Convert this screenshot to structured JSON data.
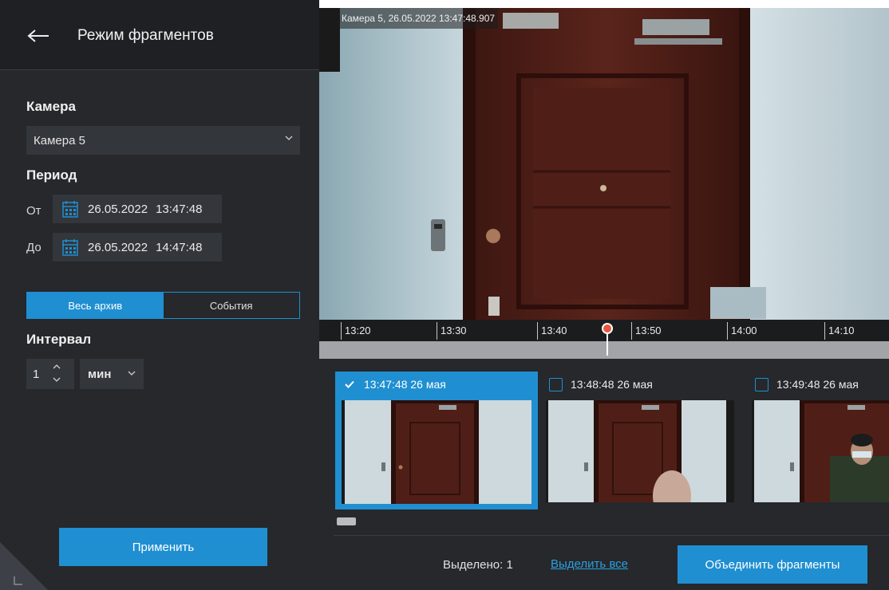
{
  "header": {
    "title": "Режим фрагментов"
  },
  "sidebar": {
    "camera_label": "Камера",
    "camera_value": "Камера 5",
    "period_label": "Период",
    "from_label": "От",
    "from_date": "26.05.2022",
    "from_time": "13:47:48",
    "to_label": "До",
    "to_date": "26.05.2022",
    "to_time": "14:47:48",
    "mode_tabs": [
      {
        "label": "Весь архив",
        "selected": true
      },
      {
        "label": "События",
        "selected": false
      }
    ],
    "interval_label": "Интервал",
    "interval_value": "1",
    "interval_unit": "мин",
    "apply_label": "Применить"
  },
  "video": {
    "caption": "Камера 5, 26.05.2022 13:47:48.907"
  },
  "timeline": {
    "ticks": [
      "13:20",
      "13:30",
      "13:40",
      "13:50",
      "14:00",
      "14:10"
    ],
    "playhead_color": "#e8553e"
  },
  "fragments": [
    {
      "label": "13:47:48 26 мая",
      "selected": true
    },
    {
      "label": "13:48:48 26 мая",
      "selected": false
    },
    {
      "label": "13:49:48 26 мая",
      "selected": false
    }
  ],
  "footer": {
    "selected_text": "Выделено: 1",
    "select_all_label": "Выделить все",
    "merge_label": "Объединить фрагменты"
  },
  "colors": {
    "accent": "#1f8fd1",
    "panel": "#26282c",
    "header": "#1e2023"
  },
  "icons": [
    "back-arrow-icon",
    "chevron-down-icon",
    "calendar-icon",
    "chevron-up-icon",
    "check-icon",
    "checkbox-icon",
    "resize-corner-icon"
  ]
}
